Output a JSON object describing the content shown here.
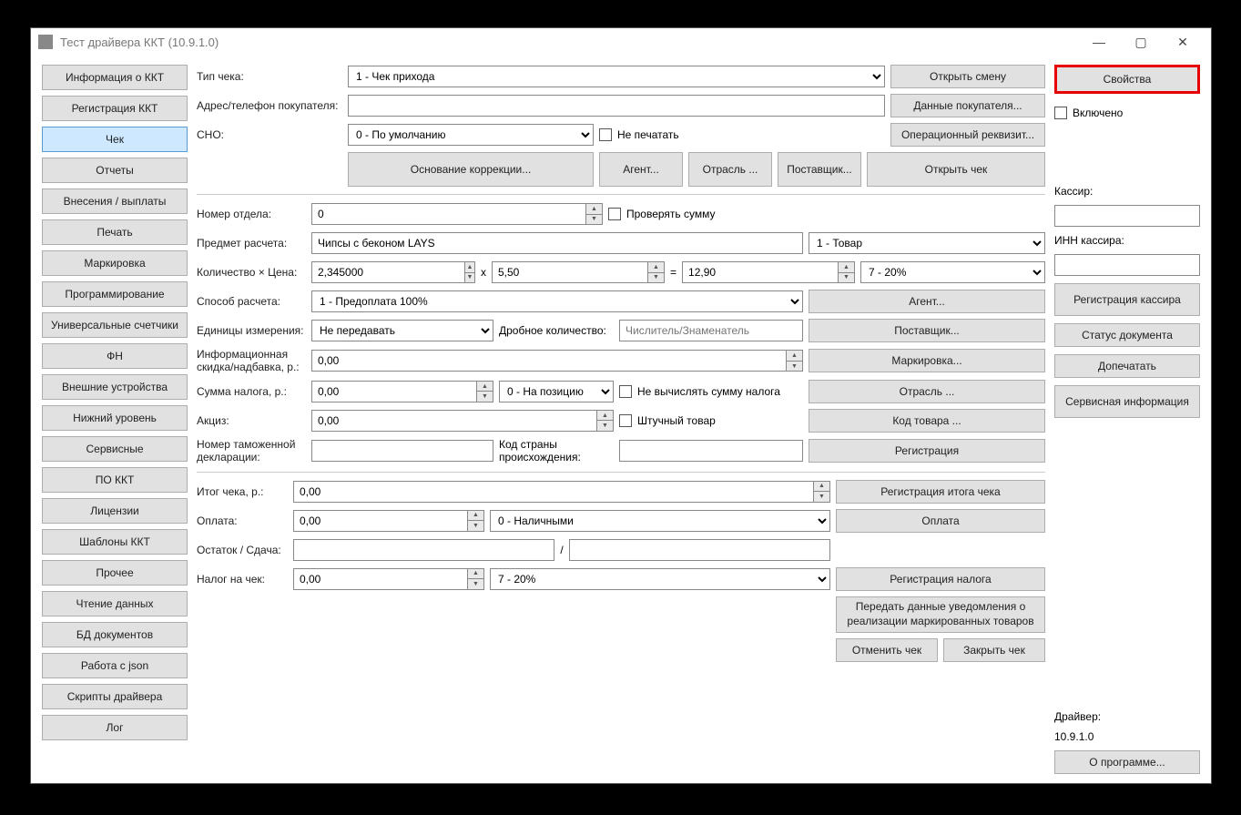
{
  "window": {
    "title": "Тест драйвера ККТ (10.9.1.0)"
  },
  "sidebar": [
    "Информация о ККТ",
    "Регистрация ККТ",
    "Чек",
    "Отчеты",
    "Внесения / выплаты",
    "Печать",
    "Маркировка",
    "Программирование",
    "Универсальные счетчики",
    "ФН",
    "Внешние устройства",
    "Нижний уровень",
    "Сервисные",
    "ПО ККТ",
    "Лицензии",
    "Шаблоны ККТ",
    "Прочее",
    "Чтение данных",
    "БД документов",
    "Работа с json",
    "Скрипты драйвера",
    "Лог"
  ],
  "sidebar_active": 2,
  "main": {
    "check_type_label": "Тип чека:",
    "check_type": "1 - Чек прихода",
    "open_shift": "Открыть смену",
    "buyer_addr_label": "Адрес/телефон покупателя:",
    "buyer_data": "Данные покупателя...",
    "sno_label": "СНО:",
    "sno": "0 - По умолчанию",
    "do_not_print": "Не печатать",
    "op_requisite": "Операционный реквизит...",
    "correction_base": "Основание коррекции...",
    "agent": "Агент...",
    "industry": "Отрасль ...",
    "supplier": "Поставщик...",
    "open_check": "Открыть чек",
    "dept_label": "Номер отдела:",
    "dept": "0",
    "check_sum": "Проверять сумму",
    "item_label": "Предмет расчета:",
    "item_name": "Чипсы с беконом LAYS",
    "item_type": "1 - Товар",
    "qty_label": "Количество × Цена:",
    "qty": "2,345000",
    "price": "5,50",
    "total": "12,90",
    "tax_rate": "7 - 20%",
    "x": "x",
    "eq": "=",
    "paytype_label": "Способ расчета:",
    "paytype": "1 - Предоплата 100%",
    "agent_btn": "Агент...",
    "units_label": "Единицы измерения:",
    "units": "Не передавать",
    "frac_label": "Дробное количество:",
    "frac_placeholder": "Числитель/Знаменатель",
    "supplier_btn": "Поставщик...",
    "discount_label": "Информационная скидка/надбавка, р.:",
    "discount": "0,00",
    "marking_btn": "Маркировка...",
    "tax_sum_label": "Сумма налога, р.:",
    "tax_sum": "0,00",
    "tax_mode": "0 - На позицию",
    "no_calc_tax": "Не вычислять сумму налога",
    "industry_btn": "Отрасль ...",
    "excise_label": "Акциз:",
    "excise": "0,00",
    "piece_item": "Штучный товар",
    "item_code_btn": "Код товара ...",
    "customs_label": "Номер таможенной декларации:",
    "origin_label": "Код страны происхождения:",
    "registration_btn": "Регистрация",
    "check_total_label": "Итог чека, р.:",
    "check_total": "0,00",
    "reg_total_btn": "Регистрация итога чека",
    "payment_label": "Оплата:",
    "payment": "0,00",
    "payment_type": "0 - Наличными",
    "payment_btn": "Оплата",
    "change_label": "Остаток / Сдача:",
    "ch_sep": "/",
    "tax_on_check_label": "Налог на чек:",
    "tax_on_check": "0,00",
    "tax_on_check_type": "7 - 20%",
    "reg_tax_btn": "Регистрация налога",
    "send_marked": "Передать данные уведомления о реализации маркированных товаров",
    "cancel_check": "Отменить чек",
    "close_check": "Закрыть чек"
  },
  "right": {
    "properties": "Свойства",
    "enabled": "Включено",
    "cashier_label": "Кассир:",
    "cashier_inn_label": "ИНН кассира:",
    "reg_cashier": "Регистрация кассира",
    "doc_status": "Статус документа",
    "reprint": "Допечатать",
    "service_info": "Сервисная информация",
    "driver_label": "Драйвер:",
    "driver_ver": "10.9.1.0",
    "about": "О программе..."
  }
}
